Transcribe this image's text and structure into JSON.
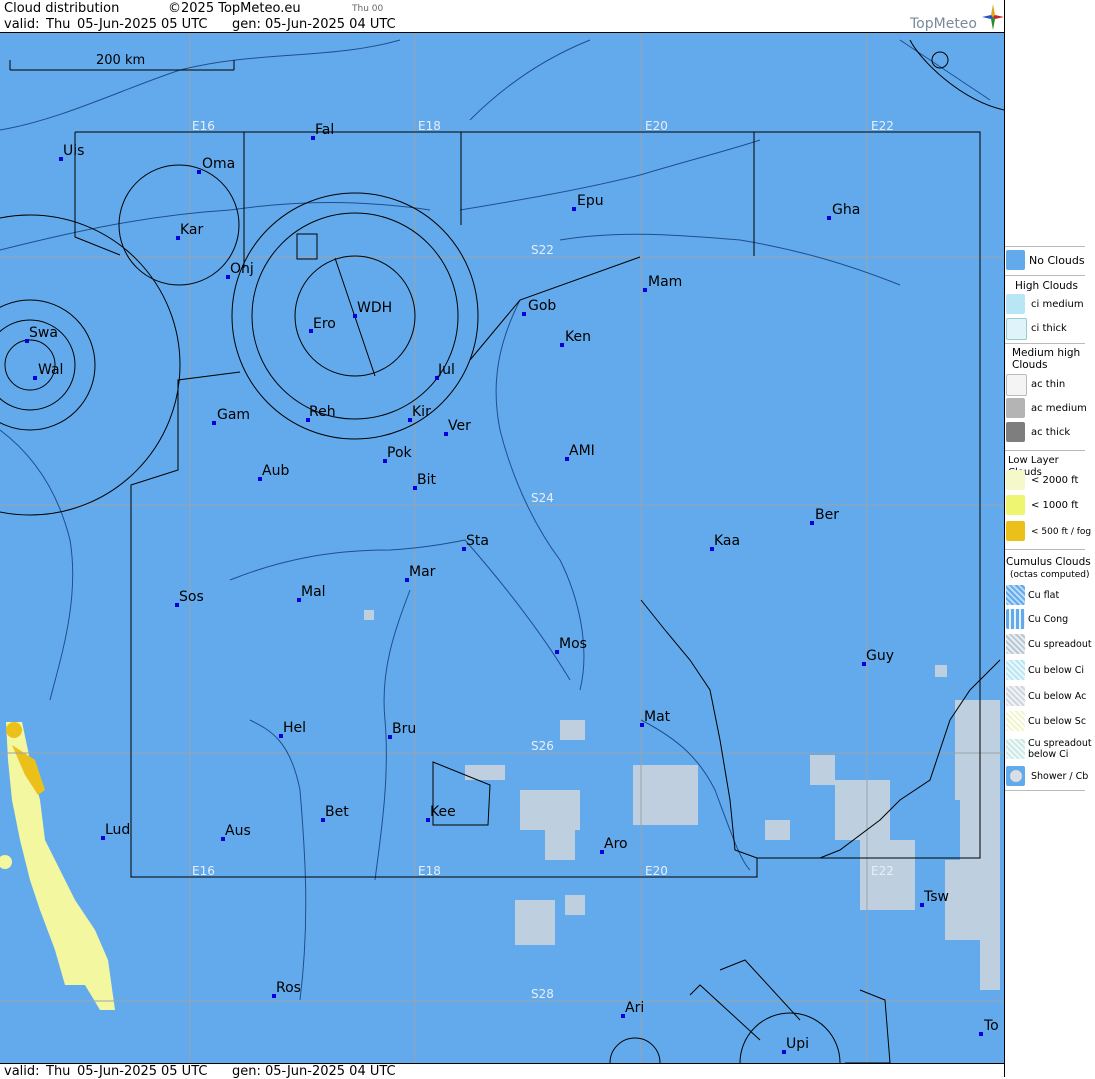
{
  "header": {
    "title": "Cloud distribution",
    "copyright": "©2025 TopMeteo.eu",
    "run_hint": "Thu 00",
    "valid_label": "valid:",
    "valid_day": "Thu",
    "valid_date": "05-Jun-2025",
    "valid_time": "05 UTC",
    "gen_label": "gen:",
    "gen_value": "05-Jun-2025 04 UTC",
    "logo_text": "TopMeteo"
  },
  "footer": {
    "valid_label": "valid:",
    "valid_day": "Thu",
    "valid_date": "05-Jun-2025",
    "valid_time": "05 UTC",
    "gen_label": "gen:",
    "gen_value": "05-Jun-2025 04 UTC"
  },
  "map": {
    "scale_label": "200 km",
    "grid_labels": [
      "E16",
      "E18",
      "E20",
      "E22",
      "S22",
      "S24",
      "S26",
      "S28"
    ],
    "cities": [
      "Uis",
      "Fal",
      "Oma",
      "Kar",
      "Epu",
      "Gha",
      "Onj",
      "WDH",
      "Ero",
      "Mam",
      "Gob",
      "Ken",
      "Swa",
      "Wal",
      "Jul",
      "Gam",
      "Reh",
      "Kir",
      "Ver",
      "Pok",
      "AMI",
      "Aub",
      "Bit",
      "Ber",
      "Kaa",
      "Sta",
      "Sos",
      "Mal",
      "Mar",
      "Mos",
      "Guy",
      "Mat",
      "Hel",
      "Bru",
      "Bet",
      "Kee",
      "Lud",
      "Aus",
      "Aro",
      "Tsw",
      "Ros",
      "Ari",
      "To",
      "Upi"
    ],
    "colors": {
      "background": "#63aaed",
      "grid": "#9aa4ad",
      "border": "#000000",
      "station": "#0000dd",
      "cumulus": "#cfd6dd",
      "low_cloud": "#f3f7a0"
    }
  },
  "legend": {
    "no_clouds": "No Clouds",
    "high_title": "High Clouds",
    "ci_medium": "ci medium",
    "ci_thick": "ci thick",
    "medium_title": "Medium high Clouds",
    "ac_thin": "ac thin",
    "ac_medium": "ac medium",
    "ac_thick": "ac thick",
    "low_title": "Low Layer Clouds",
    "low_2000": "< 2000 ft",
    "low_1000": "< 1000 ft",
    "low_500": "< 500 ft / fog",
    "cumulus_title": "Cumulus Clouds",
    "cumulus_sub": "(octas computed)",
    "cu_flat": "Cu flat",
    "cu_cong": "Cu Cong",
    "cu_spreadout": "Cu spreadout",
    "cu_below_ci": "Cu below Ci",
    "cu_below_ac": "Cu below Ac",
    "cu_below_sc": "Cu below Sc",
    "cu_spread_below_ci": "Cu spreadout below Ci",
    "shower": "Shower / Cb"
  }
}
